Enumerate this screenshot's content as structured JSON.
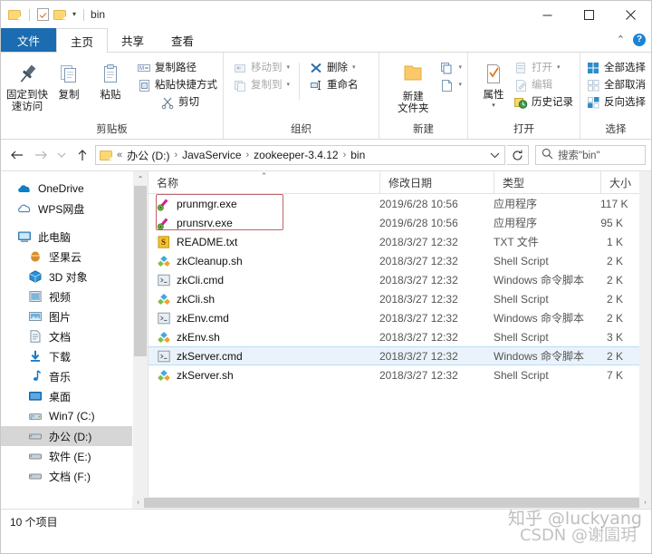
{
  "window": {
    "title": "bin",
    "quick_access": [
      "folder-icon",
      "properties-icon",
      "new-folder-icon",
      "customize-caret-icon"
    ],
    "controls": {
      "minimize": "minimize-icon",
      "maximize": "maximize-icon",
      "close": "close-icon"
    }
  },
  "ribbon": {
    "tabs": [
      {
        "label": "文件",
        "kind": "file"
      },
      {
        "label": "主页",
        "kind": "active"
      },
      {
        "label": "共享",
        "kind": "normal"
      },
      {
        "label": "查看",
        "kind": "normal"
      }
    ],
    "collapse_icon": "chevron-up-icon",
    "help_icon": "help-icon",
    "groups": [
      {
        "label": "剪贴板",
        "big": [
          {
            "label": "固定到快\n速访问",
            "icon": "pin-icon",
            "dim": false
          },
          {
            "label": "复制",
            "icon": "copy-icon",
            "dim": false
          },
          {
            "label": "粘贴",
            "icon": "paste-icon",
            "dim": false
          }
        ],
        "small": [
          {
            "label": "复制路径",
            "icon": "copy-path-icon",
            "dim": false
          },
          {
            "label": "粘贴快捷方式",
            "icon": "paste-shortcut-icon",
            "dim": false
          },
          {
            "label": "剪切",
            "icon": "scissors-icon",
            "dim": false
          }
        ]
      },
      {
        "label": "组织",
        "small": [
          {
            "label": "移动到",
            "icon": "move-to-icon",
            "dim": true,
            "caret": true
          },
          {
            "label": "复制到",
            "icon": "copy-to-icon",
            "dim": true,
            "caret": true
          },
          {
            "label": "删除",
            "icon": "delete-x-icon",
            "dim": false,
            "caret": true
          },
          {
            "label": "重命名",
            "icon": "rename-icon",
            "dim": false,
            "caret": false
          }
        ]
      },
      {
        "label": "新建",
        "big": [
          {
            "label": "新建\n文件夹",
            "icon": "new-folder-icon",
            "dim": false
          }
        ],
        "small": [
          {
            "label": "",
            "icon": "new-item-icon",
            "dim": false,
            "caret": true
          },
          {
            "label": "",
            "icon": "easy-access-icon",
            "dim": false,
            "caret": true
          }
        ]
      },
      {
        "label": "打开",
        "big": [
          {
            "label": "属性",
            "icon": "properties-icon",
            "dim": false,
            "caret": true
          }
        ],
        "small": [
          {
            "label": "打开",
            "icon": "open-icon",
            "dim": true,
            "caret": true
          },
          {
            "label": "编辑",
            "icon": "edit-icon",
            "dim": true,
            "caret": false
          },
          {
            "label": "历史记录",
            "icon": "history-icon",
            "dim": false,
            "caret": false
          }
        ]
      },
      {
        "label": "选择",
        "small": [
          {
            "label": "全部选择",
            "icon": "select-all-icon",
            "dim": false
          },
          {
            "label": "全部取消",
            "icon": "select-none-icon",
            "dim": false
          },
          {
            "label": "反向选择",
            "icon": "invert-selection-icon",
            "dim": false
          }
        ]
      }
    ]
  },
  "addressbar": {
    "back_icon": "back-arrow-icon",
    "forward_icon": "forward-arrow-icon",
    "recent_icon": "recent-locations-icon",
    "up_icon": "up-arrow-icon",
    "folder_icon": "folder-icon",
    "overflow": "«",
    "crumbs": [
      "办公 (D:)",
      "JavaService",
      "zookeeper-3.4.12",
      "bin"
    ],
    "crumb_separator": "›",
    "dropdown_icon": "chevron-down-icon",
    "refresh_icon": "refresh-icon",
    "search": {
      "icon": "search-icon",
      "placeholder": "搜索\"bin\"",
      "value": ""
    }
  },
  "navpane": {
    "items": [
      {
        "label": "OneDrive",
        "icon": "onedrive-icon",
        "indent": false,
        "selected": false
      },
      {
        "label": "WPS网盘",
        "icon": "wps-cloud-icon",
        "indent": false,
        "selected": false
      },
      {
        "label": "此电脑",
        "icon": "this-pc-icon",
        "indent": false,
        "selected": false,
        "spacer_before": true
      },
      {
        "label": "坚果云",
        "icon": "nutstore-icon",
        "indent": true,
        "selected": false
      },
      {
        "label": "3D 对象",
        "icon": "3d-objects-icon",
        "indent": true,
        "selected": false
      },
      {
        "label": "视频",
        "icon": "videos-icon",
        "indent": true,
        "selected": false
      },
      {
        "label": "图片",
        "icon": "pictures-icon",
        "indent": true,
        "selected": false
      },
      {
        "label": "文档",
        "icon": "documents-icon",
        "indent": true,
        "selected": false
      },
      {
        "label": "下载",
        "icon": "downloads-icon",
        "indent": true,
        "selected": false
      },
      {
        "label": "音乐",
        "icon": "music-icon",
        "indent": true,
        "selected": false
      },
      {
        "label": "桌面",
        "icon": "desktop-icon",
        "indent": true,
        "selected": false
      },
      {
        "label": "Win7 (C:)",
        "icon": "system-drive-icon",
        "indent": true,
        "selected": false
      },
      {
        "label": "办公 (D:)",
        "icon": "drive-icon",
        "indent": true,
        "selected": true
      },
      {
        "label": "软件 (E:)",
        "icon": "drive-icon",
        "indent": true,
        "selected": false
      },
      {
        "label": "文档 (F:)",
        "icon": "drive-icon",
        "indent": true,
        "selected": false
      }
    ],
    "scroll_up_icon": "chevron-up-icon",
    "scroll_down_icon": "chevron-down-icon"
  },
  "filelist": {
    "columns": [
      {
        "label": "名称",
        "sorted": true,
        "sort_icon": "sort-ascending-icon"
      },
      {
        "label": "修改日期",
        "sorted": false
      },
      {
        "label": "类型",
        "sorted": false
      },
      {
        "label": "大小",
        "sorted": false
      }
    ],
    "rows": [
      {
        "name": "prunmgr.exe",
        "date": "2019/6/28 10:56",
        "type": "应用程序",
        "size": "117 K",
        "icon": "exe-icon",
        "selected": false
      },
      {
        "name": "prunsrv.exe",
        "date": "2019/6/28 10:56",
        "type": "应用程序",
        "size": "95 K",
        "icon": "exe-icon",
        "selected": false
      },
      {
        "name": "README.txt",
        "date": "2018/3/27 12:32",
        "type": "TXT 文件",
        "size": "1 K",
        "icon": "txt-icon",
        "selected": false
      },
      {
        "name": "zkCleanup.sh",
        "date": "2018/3/27 12:32",
        "type": "Shell Script",
        "size": "2 K",
        "icon": "sh-icon",
        "selected": false
      },
      {
        "name": "zkCli.cmd",
        "date": "2018/3/27 12:32",
        "type": "Windows 命令脚本",
        "size": "2 K",
        "icon": "cmd-icon",
        "selected": false
      },
      {
        "name": "zkCli.sh",
        "date": "2018/3/27 12:32",
        "type": "Shell Script",
        "size": "2 K",
        "icon": "sh-icon",
        "selected": false
      },
      {
        "name": "zkEnv.cmd",
        "date": "2018/3/27 12:32",
        "type": "Windows 命令脚本",
        "size": "2 K",
        "icon": "cmd-icon",
        "selected": false
      },
      {
        "name": "zkEnv.sh",
        "date": "2018/3/27 12:32",
        "type": "Shell Script",
        "size": "3 K",
        "icon": "sh-icon",
        "selected": false
      },
      {
        "name": "zkServer.cmd",
        "date": "2018/3/27 12:32",
        "type": "Windows 命令脚本",
        "size": "2 K",
        "icon": "cmd-icon",
        "selected": true
      },
      {
        "name": "zkServer.sh",
        "date": "2018/3/27 12:32",
        "type": "Shell Script",
        "size": "7 K",
        "icon": "sh-icon",
        "selected": false
      }
    ],
    "annotation": {
      "type": "red-rectangle",
      "color": "#c0636b",
      "targets": [
        "prunmgr.exe",
        "prunsrv.exe"
      ]
    }
  },
  "statusbar": {
    "item_count": "10 个项目"
  },
  "watermarks": {
    "primary": "知乎 @luckyang",
    "secondary": "CSDN @谢圁玥"
  },
  "colors": {
    "file_tab": "#1b6cb0",
    "selection": "#eaf3fb",
    "selection_border": "#bcdcf4",
    "nav_selection": "#d6d6d6",
    "annotation": "#c0636b",
    "accent": "#1b83d4"
  }
}
